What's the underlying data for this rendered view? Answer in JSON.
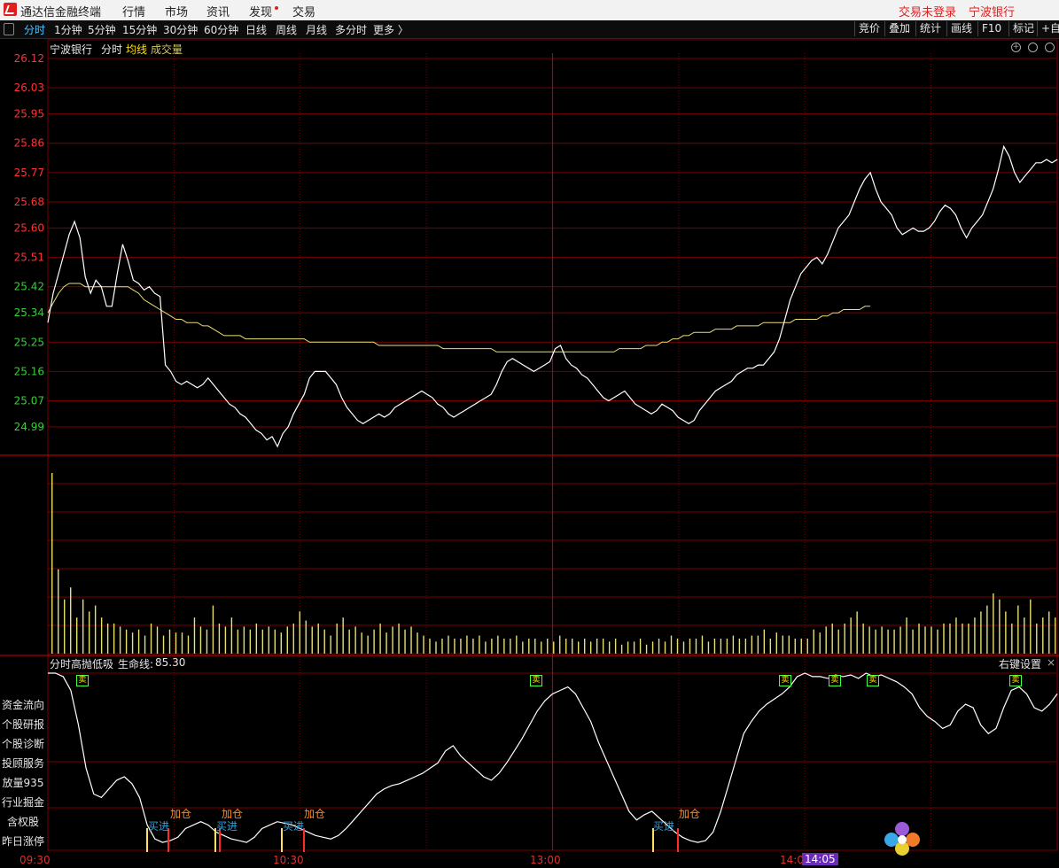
{
  "app": {
    "title": "通达信金融终端",
    "menu": [
      "行情",
      "市场",
      "资讯",
      "发现",
      "交易"
    ],
    "login_status": "交易未登录",
    "stock_name": "宁波银行"
  },
  "toolbar": {
    "periods": [
      "分时",
      "1分钟",
      "5分钟",
      "15分钟",
      "30分钟",
      "60分钟",
      "日线",
      "周线",
      "月线",
      "多分时",
      "更多 〉"
    ],
    "active_period": "分时",
    "right_buttons": [
      "竞价",
      "叠加",
      "统计",
      "画线",
      "F10",
      "标记",
      "+自"
    ]
  },
  "price_chart": {
    "stock": "宁波银行",
    "mode": "分时",
    "avg_label": "均线",
    "vol_label": "成交量",
    "colors": {
      "up": "#ff3232",
      "down": "#32d232",
      "price": "#ffffff",
      "avg": "#e8e070",
      "grid": "#7a0000",
      "volume": "#e8e070"
    }
  },
  "indicator": {
    "name": "分时高抛低吸",
    "lifeline_label": "生命线:",
    "lifeline_value": "85.30",
    "settings": "右键设置",
    "signals": [
      {
        "type": "sell",
        "label": "卖"
      },
      {
        "type": "sell",
        "label": "卖"
      },
      {
        "type": "sell",
        "label": "卖"
      },
      {
        "type": "sell",
        "label": "卖"
      },
      {
        "type": "sell",
        "label": "卖"
      },
      {
        "type": "sell",
        "label": "卖"
      },
      {
        "type": "buy",
        "label": "买进"
      },
      {
        "type": "buy",
        "label": "买进"
      },
      {
        "type": "buy",
        "label": "买进"
      },
      {
        "type": "buy",
        "label": "买进"
      },
      {
        "type": "add",
        "label": "加仓"
      },
      {
        "type": "add",
        "label": "加仓"
      },
      {
        "type": "add",
        "label": "加仓"
      },
      {
        "type": "add",
        "label": "加仓"
      }
    ]
  },
  "side_menu": [
    "资金流向",
    "个股研报",
    "个股诊断",
    "投顾服务",
    "放量935",
    "行业掘金",
    "含权股",
    "昨日涨停"
  ],
  "time_axis": {
    "labels": [
      "09:30",
      "10:30",
      "13:00",
      "14:0"
    ],
    "cursor": "14:05"
  },
  "chart_data": {
    "type": "line",
    "x_range": [
      0,
      240
    ],
    "ylim": [
      24.99,
      26.12
    ],
    "y_ticks": [
      26.12,
      26.03,
      25.95,
      25.86,
      25.77,
      25.68,
      25.6,
      25.51,
      25.42,
      25.34,
      25.25,
      25.16,
      25.07,
      24.99
    ],
    "prev_close": 25.51,
    "series": [
      {
        "values": [
          25.31,
          25.4,
          25.46,
          25.52,
          25.58,
          25.62,
          25.57,
          25.45,
          25.4,
          25.44,
          25.42,
          25.36,
          25.36,
          25.46,
          25.55,
          25.5,
          25.44,
          25.43,
          25.41,
          25.42,
          25.4,
          25.39,
          25.18,
          25.16,
          25.13,
          25.12,
          25.13,
          25.12,
          25.11,
          25.12,
          25.14,
          25.12,
          25.1,
          25.08,
          25.06,
          25.05,
          25.03,
          25.02,
          25.0,
          24.98,
          24.97,
          24.95,
          24.96,
          24.93,
          24.97,
          24.99,
          25.03,
          25.06,
          25.09,
          25.14,
          25.16,
          25.16,
          25.16,
          25.14,
          25.12,
          25.08,
          25.05,
          25.03,
          25.01,
          25.0,
          25.01,
          25.02,
          25.03,
          25.02,
          25.03,
          25.05,
          25.06,
          25.07,
          25.08,
          25.09,
          25.1,
          25.09,
          25.08,
          25.06,
          25.05,
          25.03,
          25.02,
          25.03,
          25.04,
          25.05,
          25.06,
          25.07,
          25.08,
          25.09,
          25.12,
          25.16,
          25.19,
          25.2,
          25.19,
          25.18,
          25.17,
          25.16,
          25.17,
          25.18,
          25.19,
          25.23,
          25.24,
          25.2,
          25.18,
          25.17,
          25.15,
          25.14,
          25.12,
          25.1,
          25.08,
          25.07,
          25.08,
          25.09,
          25.1,
          25.08,
          25.06,
          25.05,
          25.04,
          25.03,
          25.04,
          25.06,
          25.05,
          25.04,
          25.02,
          25.01,
          25.0,
          25.01,
          25.04,
          25.06,
          25.08,
          25.1,
          25.11,
          25.12,
          25.13,
          25.15,
          25.16,
          25.17,
          25.17,
          25.18,
          25.18,
          25.2,
          25.22,
          25.26,
          25.32,
          25.38,
          25.42,
          25.46,
          25.48,
          25.5,
          25.51,
          25.49,
          25.52,
          25.56,
          25.6,
          25.62,
          25.64,
          25.68,
          25.72,
          25.75,
          25.77,
          25.72,
          25.68,
          25.66,
          25.64,
          25.6,
          25.58,
          25.59,
          25.6,
          25.59,
          25.59,
          25.6,
          25.62,
          25.65,
          25.67,
          25.66,
          25.64,
          25.6,
          25.57,
          25.6,
          25.62,
          25.64,
          25.68,
          25.72,
          25.78,
          25.85,
          25.82,
          25.77,
          25.74,
          25.76,
          25.78,
          25.8,
          25.8,
          25.81,
          25.8,
          25.81
        ]
      },
      {
        "values": [
          25.34,
          25.37,
          25.4,
          25.42,
          25.43,
          25.43,
          25.43,
          25.42,
          25.42,
          25.42,
          25.42,
          25.42,
          25.42,
          25.42,
          25.42,
          25.42,
          25.41,
          25.4,
          25.38,
          25.37,
          25.36,
          25.35,
          25.34,
          25.33,
          25.32,
          25.32,
          25.31,
          25.31,
          25.31,
          25.3,
          25.3,
          25.29,
          25.28,
          25.27,
          25.27,
          25.27,
          25.27,
          25.26,
          25.26,
          25.26,
          25.26,
          25.26,
          25.26,
          25.26,
          25.26,
          25.26,
          25.26,
          25.26,
          25.26,
          25.25,
          25.25,
          25.25,
          25.25,
          25.25,
          25.25,
          25.25,
          25.25,
          25.25,
          25.25,
          25.25,
          25.25,
          25.25,
          25.24,
          25.24,
          25.24,
          25.24,
          25.24,
          25.24,
          25.24,
          25.24,
          25.24,
          25.24,
          25.24,
          25.24,
          25.23,
          25.23,
          25.23,
          25.23,
          25.23,
          25.23,
          25.23,
          25.23,
          25.23,
          25.23,
          25.22,
          25.22,
          25.22,
          25.22,
          25.22,
          25.22,
          25.22,
          25.22,
          25.22,
          25.22,
          25.22,
          25.22,
          25.22,
          25.22,
          25.22,
          25.22,
          25.22,
          25.22,
          25.22,
          25.22,
          25.22,
          25.22,
          25.22,
          25.23,
          25.23,
          25.23,
          25.23,
          25.23,
          25.24,
          25.24,
          25.24,
          25.25,
          25.25,
          25.26,
          25.26,
          25.27,
          25.27,
          25.28,
          25.28,
          25.28,
          25.28,
          25.29,
          25.29,
          25.29,
          25.29,
          25.3,
          25.3,
          25.3,
          25.3,
          25.3,
          25.31,
          25.31,
          25.31,
          25.31,
          25.31,
          25.31,
          25.32,
          25.32,
          25.32,
          25.32,
          25.32,
          25.33,
          25.33,
          25.34,
          25.34,
          25.35,
          25.35,
          25.35,
          25.35,
          25.36,
          25.36
        ]
      }
    ],
    "volume": [
      60,
      28,
      18,
      22,
      12,
      18,
      14,
      16,
      12,
      10,
      10,
      9,
      8,
      7,
      8,
      6,
      10,
      9,
      6,
      8,
      7,
      7,
      6,
      12,
      9,
      8,
      16,
      10,
      9,
      12,
      8,
      9,
      8,
      10,
      8,
      9,
      8,
      7,
      9,
      10,
      14,
      11,
      9,
      10,
      8,
      6,
      10,
      12,
      8,
      9,
      7,
      6,
      8,
      10,
      7,
      9,
      10,
      8,
      9,
      7,
      6,
      5,
      4,
      5,
      6,
      5,
      5,
      6,
      5,
      6,
      4,
      5,
      6,
      5,
      5,
      6,
      4,
      5,
      5,
      4,
      5,
      4,
      6,
      5,
      5,
      4,
      5,
      4,
      5,
      5,
      4,
      5,
      3,
      4,
      4,
      5,
      3,
      4,
      5,
      4,
      6,
      5,
      4,
      5,
      5,
      6,
      4,
      5,
      5,
      5,
      6,
      5,
      5,
      6,
      6,
      8,
      5,
      7,
      6,
      6,
      5,
      5,
      5,
      8,
      7,
      9,
      10,
      8,
      10,
      12,
      14,
      10,
      9,
      8,
      9,
      8,
      8,
      9,
      12,
      8,
      10,
      9,
      9,
      8,
      10,
      10,
      12,
      10,
      10,
      12,
      14,
      16,
      20,
      18,
      14,
      10,
      16,
      12,
      18,
      10,
      12,
      14,
      12
    ],
    "indicator_values": [
      100,
      100,
      98,
      90,
      70,
      45,
      30,
      28,
      33,
      38,
      40,
      36,
      28,
      12,
      4,
      2,
      3,
      5,
      10,
      12,
      14,
      12,
      8,
      6,
      4,
      3,
      2,
      5,
      10,
      12,
      14,
      13,
      12,
      10,
      8,
      6,
      5,
      4,
      6,
      10,
      15,
      20,
      25,
      30,
      33,
      35,
      36,
      38,
      40,
      42,
      45,
      48,
      55,
      58,
      52,
      48,
      44,
      40,
      38,
      42,
      48,
      55,
      62,
      70,
      78,
      84,
      88,
      90,
      92,
      88,
      80,
      72,
      60,
      50,
      40,
      30,
      20,
      15,
      18,
      20,
      16,
      12,
      8,
      5,
      3,
      2,
      3,
      8,
      20,
      35,
      50,
      65,
      72,
      78,
      82,
      85,
      88,
      92,
      98,
      100,
      98,
      98,
      97,
      99,
      98,
      99,
      97,
      100,
      98,
      99,
      97,
      95,
      92,
      88,
      80,
      75,
      72,
      68,
      70,
      78,
      82,
      80,
      70,
      65,
      68,
      80,
      90,
      92,
      88,
      80,
      78,
      82,
      88
    ]
  }
}
